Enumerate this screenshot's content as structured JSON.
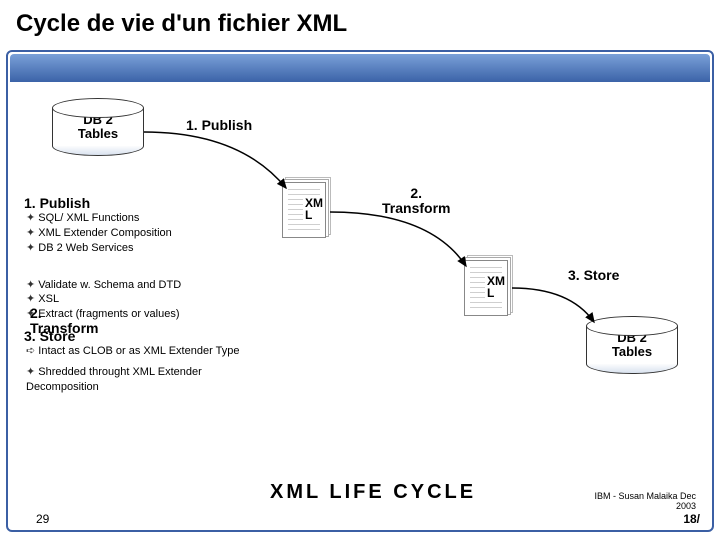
{
  "title": "Cycle de vie d'un fichier XML",
  "db_left": "DB 2\nTables",
  "db_right": "DB 2\nTables",
  "step1_label_top": "1. Publish",
  "step2_label": "2.\nTransform",
  "step3_label": "3. Store",
  "xml_label_1": "XM\nL",
  "xml_label_2": "XM\nL",
  "left": {
    "h1": "1. Publish",
    "b1a": "SQL/ XML Functions",
    "b1b": "XML Extender Composition",
    "b1c": "DB 2 Web Services",
    "h2": "2.\nTransform",
    "b2a": "Validate w. Schema and DTD",
    "b2b": "XSL",
    "b2c": "Extract (fragments or values)",
    "h3": "3. Store",
    "b3a": "Intact as CLOB or as XML Extender Type",
    "b3b": "Shredded throught XML Extender Decomposition"
  },
  "lifecycle": "XML   LIFE   CYCLE",
  "attribution": "IBM - Susan Malaika Dec\n2003",
  "slide_left": "29",
  "slide_right": "18/"
}
